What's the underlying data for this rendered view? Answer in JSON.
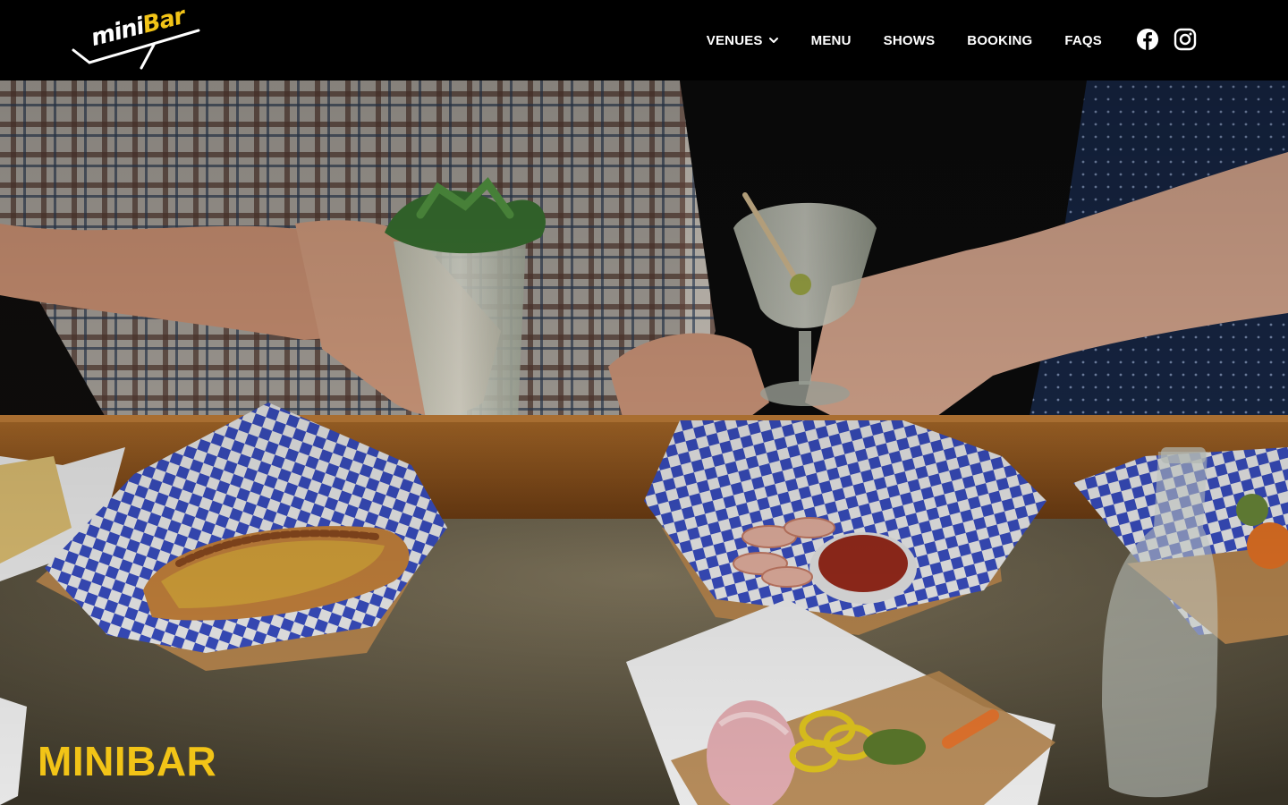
{
  "brand": {
    "logo_text_part1": "mini",
    "logo_text_part2": "Bar",
    "accent_color": "#f2c417"
  },
  "nav": {
    "items": [
      {
        "label": "VENUES",
        "has_dropdown": true,
        "icon": "chevron-down-icon"
      },
      {
        "label": "MENU"
      },
      {
        "label": "SHOWS"
      },
      {
        "label": "BOOKING"
      },
      {
        "label": "FAQS"
      }
    ]
  },
  "social": [
    {
      "name": "facebook",
      "icon": "facebook-icon"
    },
    {
      "name": "instagram",
      "icon": "instagram-icon"
    }
  ],
  "hero": {
    "title": "MINIBAR"
  }
}
